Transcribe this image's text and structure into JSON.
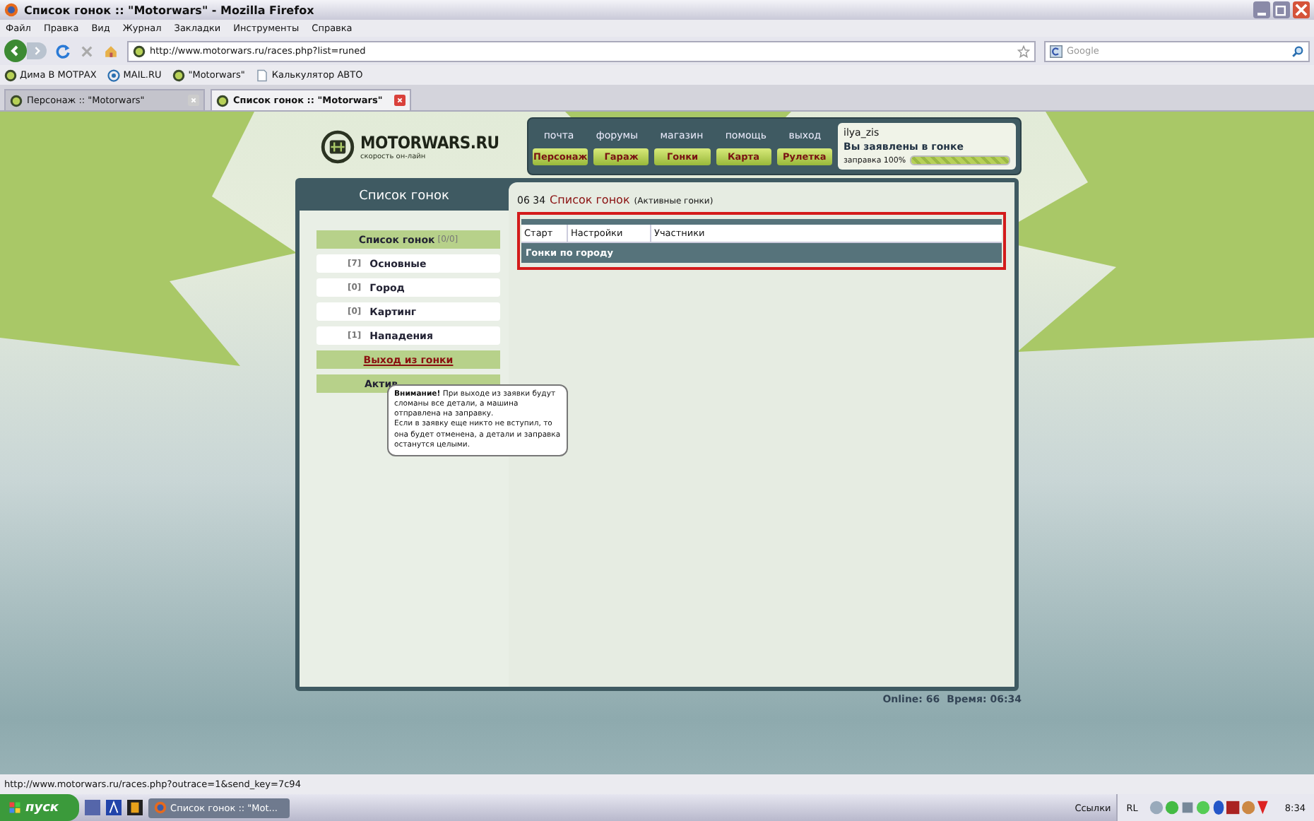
{
  "window": {
    "title": "Список гонок :: \"Motorwars\" - Mozilla Firefox"
  },
  "menu": [
    "Файл",
    "Правка",
    "Вид",
    "Журнал",
    "Закладки",
    "Инструменты",
    "Справка"
  ],
  "address": {
    "value": "http://www.motorwars.ru/races.php?list=runed"
  },
  "search": {
    "placeholder": "Google"
  },
  "bookmarks": [
    "Дима В МОТРАХ",
    "MAIL.RU",
    "\"Motorwars\"",
    "Калькулятор АВТО"
  ],
  "tabs": [
    {
      "label": "Персонаж :: \"Motorwars\"",
      "selected": false
    },
    {
      "label": "Список гонок :: \"Motorwars\"",
      "selected": true
    }
  ],
  "site": {
    "logo": "MOTORWARS.RU",
    "tagline": "скорость он-лайн",
    "top_links": [
      "почта",
      "форумы",
      "магазин",
      "помощь",
      "выход"
    ],
    "nav_buttons": [
      "Персонаж",
      "Гараж",
      "Гонки",
      "Карта",
      "Рулетка"
    ],
    "user": {
      "name": "ilya_zis",
      "status": "Вы заявлены в гонке",
      "fuel_label": "заправка 100%",
      "level": 1
    }
  },
  "sidebar": {
    "title": "Список гонок",
    "header": {
      "label": "Список гонок",
      "count": "[0/0]"
    },
    "items": [
      {
        "count": "[7]",
        "label": "Основные"
      },
      {
        "count": "[0]",
        "label": "Город"
      },
      {
        "count": "[0]",
        "label": "Картинг"
      },
      {
        "count": "[1]",
        "label": "Нападения"
      }
    ],
    "exit_link": "Выход из гонки",
    "active_button": "Актив"
  },
  "content": {
    "time": "06 34",
    "title": "Список гонок",
    "subtitle": "(Активные гонки)",
    "table": {
      "columns": [
        "Старт",
        "Настройки",
        "Участники"
      ],
      "group_row": "Гонки по городу"
    }
  },
  "tooltip": {
    "text": "**Внимание!** При выходе из заявки будут сломаны все детали, а машина отправлена на заправку.\nЕсли в заявку еще никто не вступил, то она будет отменена, а детали и заправка останутся целыми."
  },
  "footer": {
    "online": "Online: 66",
    "time": "Время: 06:34"
  },
  "status_bar": {
    "text": "http://www.motorwars.ru/races.php?outrace=1&send_key=7c94"
  },
  "taskbar": {
    "start": "пуск",
    "tasks": [
      {
        "label": "Список гонок :: \"Mot...",
        "selected": true
      }
    ],
    "links": "Ссылки",
    "lang": "RL",
    "clock": "8:34"
  }
}
